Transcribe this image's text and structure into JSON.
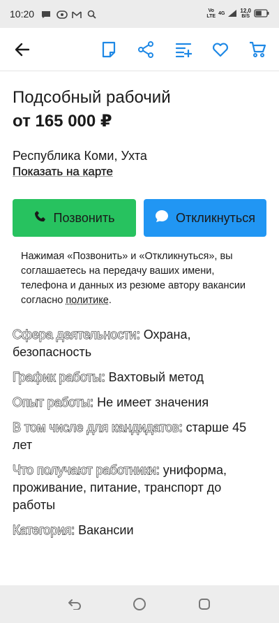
{
  "status_bar": {
    "time": "10:20",
    "icons_left": [
      "message-icon",
      "chat-bubble-icon",
      "gmail-icon",
      "search-icon"
    ],
    "network_top": "Vo",
    "network_bottom": "LTE",
    "signal_label": "4G",
    "speed_value": "12,0",
    "speed_unit": "B/S",
    "battery_level": 0.55
  },
  "toolbar": {
    "icons": [
      "back-arrow-icon",
      "note-icon",
      "share-icon",
      "add-to-list-icon",
      "heart-icon",
      "cart-icon"
    ]
  },
  "vacancy": {
    "title": "Подсобный рабочий",
    "salary": "от 165 000 ₽",
    "location": "Республика Коми, Ухта",
    "map_link": "Показать на карте"
  },
  "actions": {
    "call_label": "Позвонить",
    "respond_label": "Откликнуться",
    "call_color": "#27c25f",
    "respond_color": "#2196f3"
  },
  "consent": {
    "text": "Нажимая «Позвонить» и «Откликнуться», вы соглашаетесь на передачу ваших имени, телефона и данных из резюме автору вакансии согласно ",
    "link": "политике",
    "end": "."
  },
  "facts": [
    {
      "label": "Сфера деятельности:",
      "value": " Охрана, безопасность"
    },
    {
      "label": "График работы:",
      "value": " Вахтовый метод"
    },
    {
      "label": "Опыт работы:",
      "value": " Не имеет значения"
    },
    {
      "label": "В том числе для кандидатов:",
      "value": " старше 45 лет"
    },
    {
      "label": "Что получают работники:",
      "value": " униформа, проживание, питание, транспорт до работы"
    },
    {
      "label": "Категория:",
      "value": " Вакансии"
    }
  ],
  "nav_bar": {
    "icons": [
      "back-nav-icon",
      "home-nav-icon",
      "recents-nav-icon"
    ]
  }
}
